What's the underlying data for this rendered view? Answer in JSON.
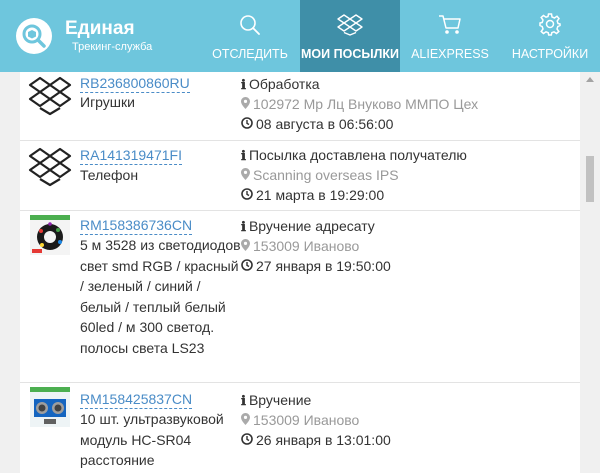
{
  "app": {
    "title": "Единая",
    "subtitle": "Трекинг-служба"
  },
  "nav": [
    {
      "label": "ОТСЛЕДИТЬ",
      "icon": "search-icon",
      "active": false
    },
    {
      "label": "МОИ ПОСЫЛКИ",
      "icon": "dropbox-icon",
      "active": true
    },
    {
      "label": "ALIEXPRESS",
      "icon": "cart-icon",
      "active": false
    },
    {
      "label": "НАСТРОЙКИ",
      "icon": "gear-icon",
      "active": false
    }
  ],
  "parcels": [
    {
      "track": "RB236800860RU",
      "title": "Игрушки",
      "status": "Обработка",
      "location": "102972 Мр Лц Внуково ММПО Цех",
      "date": "08 августа в 06:56:00",
      "thumb": "dropbox-icon"
    },
    {
      "track": "RA141319471FI",
      "title": "Телефон",
      "status": "Посылка доставлена получателю",
      "location": "Scanning overseas IPS",
      "date": "21 марта в 19:29:00",
      "thumb": "dropbox-icon"
    },
    {
      "track": "RM158386736CN",
      "title": "5 м 3528 из светодиодов свет smd RGB / красный / зеленый / синий / белый / теплый белый 60led / м 300 светод. полосы света LS23",
      "status": "Вручение адресату",
      "location": "153009 Иваново",
      "date": "27 января в 19:50:00",
      "thumb": "led-strip-photo"
    },
    {
      "track": "RM158425837CN",
      "title": "10 шт. ультразвуковой модуль HC-SR04 расстояние",
      "status": "Вручение",
      "location": "153009 Иваново",
      "date": "26 января в 13:01:00",
      "thumb": "sensor-module-photo"
    }
  ]
}
